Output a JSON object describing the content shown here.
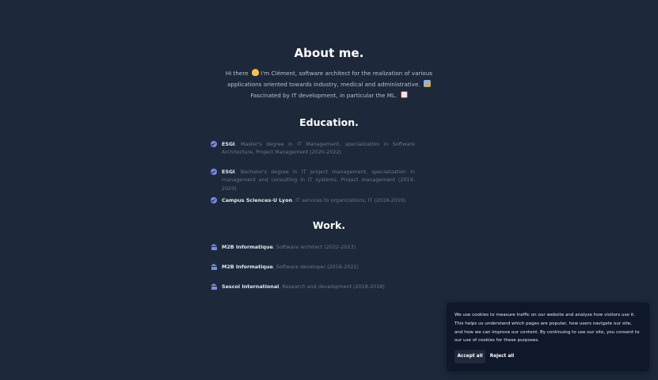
{
  "about": {
    "title": "About me.",
    "line1": "Hi there",
    "line1b": "I'm Clément, software architect for the realization of various",
    "line2": "applications oriented towards industry, medical and administrative.",
    "line3": "Fascinated by IT development, in particular the ML."
  },
  "education": {
    "title": "Education.",
    "items": [
      {
        "name": "ESGI",
        "detail": ", Master's degree in IT Management, specialization in Software Architecture, Project Management (2020-2022)"
      },
      {
        "name": "ESGI",
        "detail": ", Bachelor's degree in IT project management, specialization in management and consulting in IT systems, Project management (2019-2020)"
      },
      {
        "name": "Campus Sciences-U Lyon",
        "detail": ", IT services to organizations, IT (2018-2019)"
      }
    ]
  },
  "work": {
    "title": "Work.",
    "items": [
      {
        "name": "M2B Informatique",
        "detail": ", Software architect (2022-2023)"
      },
      {
        "name": "M2B Informatique",
        "detail": ", Software developer (2018-2022)"
      },
      {
        "name": "Sescoi International",
        "detail": ", Research and development (2018-2018)"
      }
    ]
  },
  "cookie": {
    "message": "We use cookies to measure traffic on our website and analyze how visitors use it. This helps us understand which pages are popular, how users navigate our site, and how we can improve our content. By continuing to use our site, you consent to our use of cookies for these purposes.",
    "accept_label": "Accept all",
    "reject_label": "Reject all"
  },
  "icons": {
    "education_item": "check-circle-icon",
    "work_item": "building-icon"
  },
  "colors": {
    "background": "#1d283a",
    "accent": "#7a8ce8",
    "banner": "#0f172a"
  }
}
